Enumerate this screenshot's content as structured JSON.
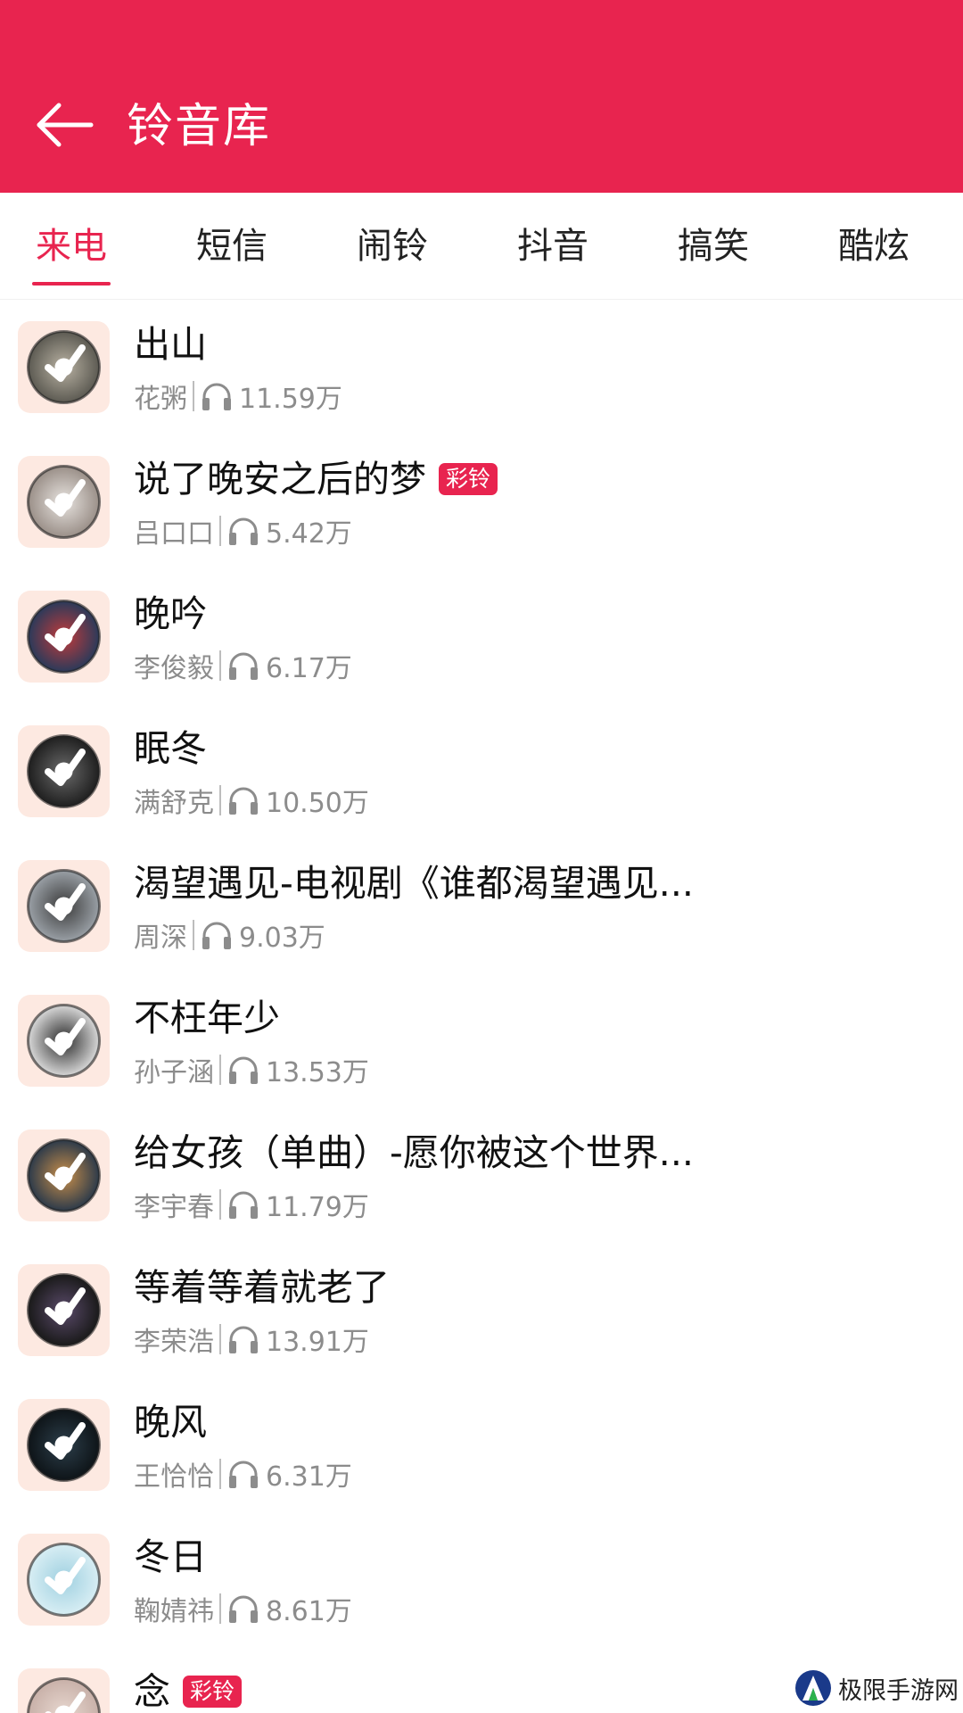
{
  "header": {
    "title": "铃音库",
    "back_icon": "arrow-left-icon",
    "background_color": "#E8244F"
  },
  "tabs": [
    {
      "label": "来电",
      "active": true
    },
    {
      "label": "短信",
      "active": false
    },
    {
      "label": "闹铃",
      "active": false
    },
    {
      "label": "抖音",
      "active": false
    },
    {
      "label": "搞笑",
      "active": false
    },
    {
      "label": "酷炫",
      "active": false
    }
  ],
  "badge_label": "彩铃",
  "songs": [
    {
      "title": "出山",
      "artist": "花粥",
      "plays": "11.59万",
      "badge": false
    },
    {
      "title": "说了晚安之后的梦",
      "artist": "吕口口",
      "plays": "5.42万",
      "badge": true
    },
    {
      "title": "晚吟",
      "artist": "李俊毅",
      "plays": "6.17万",
      "badge": false
    },
    {
      "title": "眠冬",
      "artist": "满舒克",
      "plays": "10.50万",
      "badge": false
    },
    {
      "title": "渴望遇见-电视剧《谁都渴望遇见...",
      "artist": "周深",
      "plays": "9.03万",
      "badge": false
    },
    {
      "title": "不枉年少",
      "artist": "孙子涵",
      "plays": "13.53万",
      "badge": false
    },
    {
      "title": "给女孩（单曲）-愿你被这个世界...",
      "artist": "李宇春",
      "plays": "11.79万",
      "badge": false
    },
    {
      "title": "等着等着就老了",
      "artist": "李荣浩",
      "plays": "13.91万",
      "badge": false
    },
    {
      "title": "晚风",
      "artist": "王恰恰",
      "plays": "6.31万",
      "badge": false
    },
    {
      "title": "冬日",
      "artist": "鞠婧祎",
      "plays": "8.61万",
      "badge": false
    },
    {
      "title": "念",
      "artist": "",
      "plays": "",
      "badge": true
    }
  ],
  "watermark": {
    "text": "极限手游网"
  }
}
